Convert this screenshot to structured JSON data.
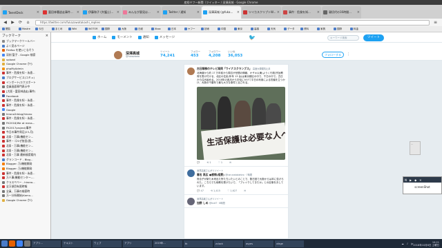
{
  "window": {
    "title": "産経ヤフー新聞（ツイッター / 深澤高城 - Google Chrome"
  },
  "tabs": [
    {
      "label": "TweetDeck",
      "color": "#1da1f2",
      "active": false
    },
    {
      "label": "富田林署逃走事件...",
      "color": "#d33",
      "active": false
    },
    {
      "label": "伊藤和子 (弁護士)...",
      "color": "#1da1f2",
      "active": false
    },
    {
      "label": "みんなが意見は...",
      "color": "#e79",
      "active": false
    },
    {
      "label": "Twitter / 通知",
      "color": "#1da1f2",
      "active": false
    },
    {
      "label": "深澤高城 (@fuka...",
      "color": "#1da1f2",
      "active": true
    },
    {
      "label": "ツイカスクリプトW...",
      "color": "#c33",
      "active": false
    },
    {
      "label": "事件：危険を知...",
      "color": "#c44",
      "active": false
    },
    {
      "label": "親切代の16時間...",
      "color": "#666",
      "active": false
    }
  ],
  "nav": {
    "url": "https://twitter.com/fukazawatakashi_replies",
    "back": "◀",
    "forward": "▶",
    "reload": "⟳",
    "home": "⌂",
    "menu": "≡"
  },
  "bookmarks_toolbar": [
    "閲覧",
    "Mostre",
    "今日",
    "まとめ",
    "Wiki",
    "WOTOR",
    "国際",
    "大阪",
    "日経",
    "Xbox",
    "日本",
    "ヤフー",
    "技術",
    "中国",
    "東京",
    "高橋",
    "天気",
    "データ",
    "資料",
    "家具",
    "国際",
    "料金"
  ],
  "sidebar": {
    "title": "ブックマーク",
    "close": "×",
    "items": [
      {
        "label": "ブックマークツールバー",
        "color": "#888"
      },
      {
        "label": "よく見るページ",
        "color": "#4a7cc9"
      },
      {
        "label": "Firefox を使いこなそう",
        "color": "#e66000"
      },
      {
        "label": "深刻 聖子 - Google 検索",
        "color": "#4285f4"
      },
      {
        "label": "upload",
        "color": "#e0b040"
      },
      {
        "label": "Google Chrome から",
        "color": "#e0b040"
      },
      {
        "label": "phpMyAdmin",
        "color": "#f29111"
      },
      {
        "label": "事件・危険を知・永遠...",
        "color": "#c33"
      },
      {
        "label": "ブログサービス(コミュ)",
        "color": "#4a7cc9"
      },
      {
        "label": "インポート/エクスポート",
        "color": "#c33"
      },
      {
        "label": "会員画面専門表示中",
        "color": "#777"
      },
      {
        "label": "[大阪・富田林逃走(事件)",
        "color": "#c33"
      },
      {
        "label": "Facebook",
        "color": "#3b5998"
      },
      {
        "label": "事件・危険を知・永遠...",
        "color": "#c33"
      },
      {
        "label": "事件・危険を知・永遠...",
        "color": "#c33"
      },
      {
        "label": "Google",
        "color": "#4285f4"
      },
      {
        "label": "hirono2rblog/hirono",
        "color": "#777"
      },
      {
        "label": "事件・危険を知・永遠...",
        "color": "#c33"
      },
      {
        "label": "FK2018/We at mess...",
        "color": "#777"
      },
      {
        "label": "FK2017project/事件",
        "color": "#777"
      },
      {
        "label": "今日の事件周辺(23-月)",
        "color": "#c33"
      },
      {
        "label": "北条・万事(機能セン...",
        "color": "#c33"
      },
      {
        "label": "事件・ゴルぜ依田(過...",
        "color": "#c33"
      },
      {
        "label": "北条・万事(機能セン...",
        "color": "#c33"
      },
      {
        "label": "北条・万事(機能セン...",
        "color": "#c33"
      },
      {
        "label": "北条・万事 最新検索案内",
        "color": "#c33"
      },
      {
        "label": "グランコード - Blog...",
        "color": "#4a7cc9"
      },
      {
        "label": "Blogger: 万/機能開発",
        "color": "#f57d00"
      },
      {
        "label": "Blogger: 万/機能開発",
        "color": "#f57d00"
      },
      {
        "label": "事件・危険を知・永遠...",
        "color": "#c33"
      },
      {
        "label": "万人事(機能センター-...",
        "color": "#c33"
      },
      {
        "label": "クラスペベー - hirono...",
        "color": "#777"
      },
      {
        "label": "全万項目有限時報",
        "color": "#c33"
      },
      {
        "label": "全員、万事の検索時",
        "color": "#777"
      },
      {
        "label": "万一分析開始(Kamu...",
        "color": "#777"
      },
      {
        "label": "Google Chrome から",
        "color": "#e0b040"
      }
    ]
  },
  "twitter": {
    "nav": [
      "ホーム",
      "モーメント",
      "通知",
      "メッセージ"
    ],
    "search_placeholder": "キーワード検索",
    "tweet_button": "ツイート",
    "logo": "🐦",
    "profile": {
      "name": "深澤高城",
      "handle": "@fukazawa",
      "stats": [
        {
          "label": "ツイート",
          "value": "74,241"
        },
        {
          "label": "フォロー",
          "value": "453"
        },
        {
          "label": "フォロワー",
          "value": "4,208"
        },
        {
          "label": "いいね",
          "value": "36,053"
        }
      ],
      "follow_button": "フォローする",
      "more": "⋮"
    },
    "tweets": [
      {
        "retweet_line": "",
        "name": "古日精株のテレビ局同「ワイナスクランブス」",
        "handle": "高速大規模抗止弁",
        "body": "北海道から約 17 万年前から周辺が世間の情報、オザキ以東(ようく行政)宗旨教育を受け付ける、北区の住民(年年 13 台)は東京都区の中で、千日の中で。古日から住み始める。2018年の各月から中旬にかけて平日の利用による抗議を立つかけ、大阪の千葉年で最も大きな事件と目される。",
        "actions": [
          "💬",
          "⟲ 1",
          "♡ 1",
          "✉"
        ],
        "avatar": "#b07a53",
        "has_photo": true,
        "photo_text": "生活保護は必要な人へ"
      },
      {
        "retweet_line": "深澤高城さんがリツイート",
        "name": "春名 高広 ●感情(相貫)",
        "handle": "@harunatakahiro · 7時間",
        "body": "府合子が新た木来出た所たちいたいとのことで、数日回で大阪からは本に告げられた。こちらでも他教を受けたいで、「ブレイクしてきたか」との記事をおしています。",
        "actions": [
          "💬 47",
          "⟲ 1,415",
          "♡ 1,627",
          "✉"
        ],
        "avatar": "#3f6d9e",
        "has_photo": false
      },
      {
        "retweet_line": "深澤高城さんがリツイート",
        "name": "加野 しめ",
        "handle": "@hrzt7 · 8時間",
        "body": "",
        "actions": [],
        "avatar": "#667",
        "has_photo": false
      }
    ]
  },
  "widgets": {
    "chat": "…",
    "screen": {
      "bar_items": [
        "N",
        "▶",
        "◆",
        "✕"
      ],
      "label": "screenShot"
    }
  },
  "taskbar": {
    "items": [
      "アプリ...",
      "テキスト",
      "ウェブ",
      "アプリ",
      "2019年...",
      "tk",
      "zclock",
      "asyes",
      "xfage"
    ],
    "tray": [
      "☁",
      "♪",
      "jp"
    ],
    "time": "19:21",
    "date": "2018年10月6日 土曜日"
  }
}
